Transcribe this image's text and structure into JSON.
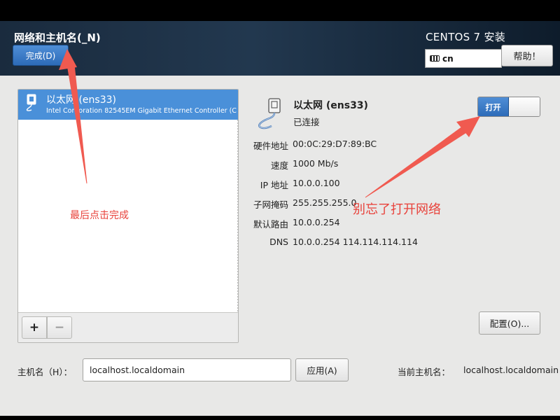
{
  "header": {
    "title": "网络和主机名(_N)",
    "done_label": "完成(D)",
    "product": "CENTOS 7 安装",
    "keyboard_layout": "cn",
    "keyboard_icon": "keyboard-icon",
    "help_label": "帮助！",
    "accent_color": "#3b7fcf"
  },
  "devices": {
    "items": [
      {
        "name": "以太网 (ens33)",
        "description": "Intel Corporation 82545EM Gigabit Ethernet Controller (C",
        "icon": "ethernet-icon",
        "selected": true
      }
    ],
    "add_label": "+",
    "remove_label": "−"
  },
  "details": {
    "name": "以太网 (ens33)",
    "status": "已连接",
    "toggle_label": "打开",
    "toggle_on": true,
    "properties": [
      {
        "label": "硬件地址",
        "value": "00:0C:29:D7:89:BC"
      },
      {
        "label": "速度",
        "value": "1000 Mb/s"
      },
      {
        "label": "IP 地址",
        "value": "10.0.0.100"
      },
      {
        "label": "子网掩码",
        "value": "255.255.255.0"
      },
      {
        "label": "默认路由",
        "value": "10.0.0.254"
      },
      {
        "label": "DNS",
        "value": "10.0.0.254 114.114.114.114"
      }
    ],
    "configure_label": "配置(O)..."
  },
  "hostname": {
    "label": "主机名（H）：",
    "value": "localhost.localdomain",
    "apply_label": "应用(A)",
    "current_label": "当前主机名：",
    "current_value": "localhost.localdomain"
  },
  "annotations": {
    "finish_note": "最后点击完成",
    "network_note": "别忘了打开网络",
    "color": "#e8413a"
  }
}
